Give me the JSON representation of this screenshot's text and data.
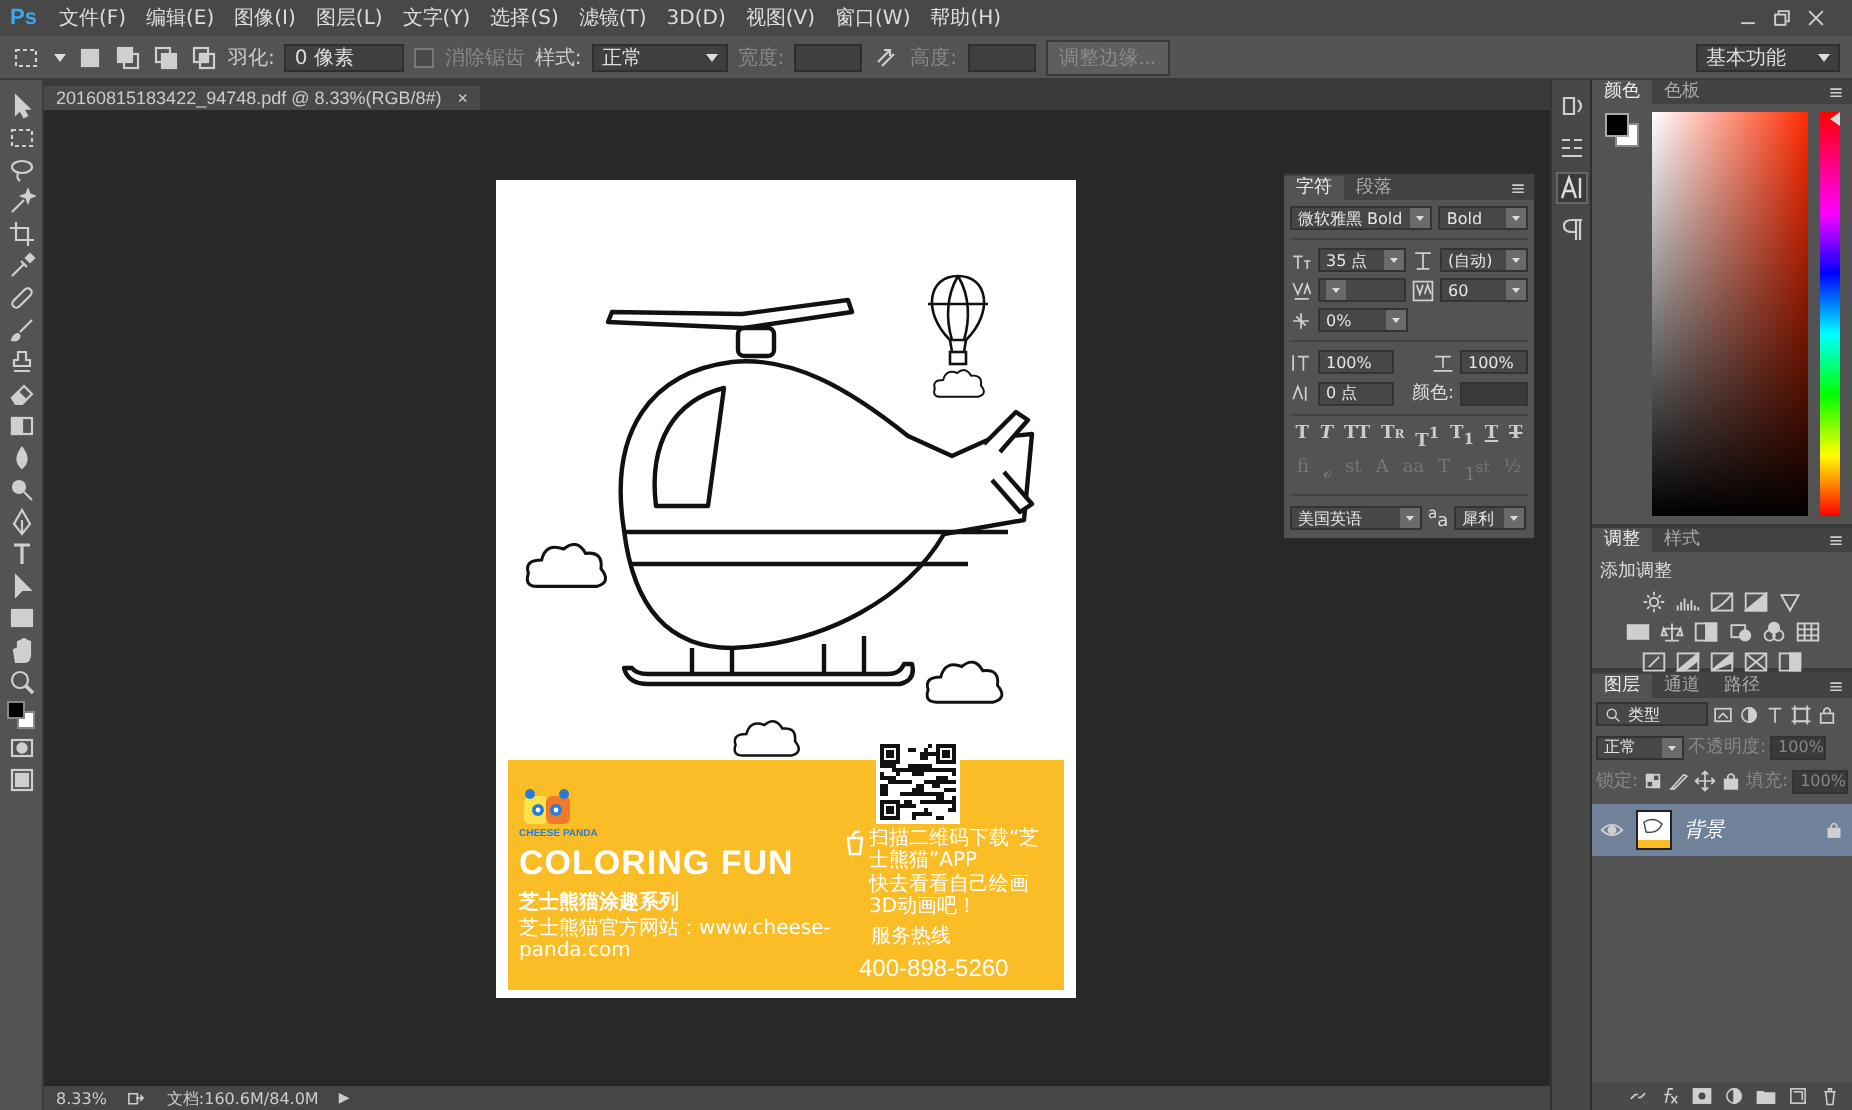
{
  "menu_bar": {
    "logo": "Ps",
    "items": [
      "文件(F)",
      "编辑(E)",
      "图像(I)",
      "图层(L)",
      "文字(Y)",
      "选择(S)",
      "滤镜(T)",
      "3D(D)",
      "视图(V)",
      "窗口(W)",
      "帮助(H)"
    ]
  },
  "options_bar": {
    "feather_label": "羽化:",
    "feather_value": "0 像素",
    "anti_alias": {
      "label": "消除锯齿",
      "checked": false,
      "disabled": true
    },
    "style_label": "样式:",
    "style_value": "正常",
    "width_label": "宽度:",
    "height_label": "高度:",
    "refine_edge": {
      "label": "调整边缘...",
      "disabled": true
    },
    "workspace": "基本功能"
  },
  "document": {
    "tab_title": "20160815183422_94748.pdf @ 8.33%(RGB/8#)",
    "tab_close": "×",
    "artwork": {
      "logo_text": "CHEESE PANDA",
      "headline": "COLORING FUN",
      "series": "芝士熊猫涂趣系列",
      "website": "芝士熊猫官方网站：www.cheese-panda.com",
      "app_lines": [
        "扫描二维码下载“芝士熊猫”APP",
        "快去看看自己绘画3D动画吧！"
      ],
      "hotline_label": "服务热线",
      "hotline": "400-898-5260"
    }
  },
  "character_panel": {
    "tabs": [
      {
        "label": "字符",
        "selected": true
      },
      {
        "label": "段落",
        "selected": false
      }
    ],
    "font_family": "微软雅黑 Bold",
    "font_style": "Bold",
    "font_size": "35 点",
    "leading": "(自动)",
    "tracking": "60",
    "tsume": "0%",
    "vertical_scale": "100%",
    "horizontal_scale": "100%",
    "baseline_shift": "0 点",
    "color_label": "颜色:",
    "style_buttons": [
      {
        "label": "T",
        "kind": "regular"
      },
      {
        "label": "T",
        "kind": "italic"
      },
      {
        "label": "TT",
        "kind": "caps"
      },
      {
        "label": "Tr",
        "kind": "smallcaps"
      },
      {
        "label": "T$^{1}$",
        "kind": "super"
      },
      {
        "label": "T$_{1}$",
        "kind": "sub"
      },
      {
        "label": "T",
        "kind": "underline"
      },
      {
        "label": "T",
        "kind": "strike"
      }
    ],
    "opentype_buttons": [
      {
        "label": "fi",
        "disabled": true
      },
      {
        "label": "ℴ",
        "disabled": true
      },
      {
        "label": "st",
        "disabled": true
      },
      {
        "label": "A",
        "disabled": true
      },
      {
        "label": "aa",
        "disabled": true
      },
      {
        "label": "T",
        "disabled": true
      },
      {
        "label": "1$^{st}$",
        "disabled": true
      },
      {
        "label": "½",
        "disabled": true
      }
    ],
    "language": "美国英语",
    "antialias_label": "$^{a}$a",
    "antialias": "犀利"
  },
  "color_panel": {
    "tabs": [
      {
        "label": "颜色",
        "selected": true
      },
      {
        "label": "色板",
        "selected": false
      }
    ],
    "hue_slider": {
      "level": 1
    }
  },
  "adjustments_panel": {
    "tabs": [
      {
        "label": "调整",
        "selected": true
      },
      {
        "label": "样式",
        "selected": false
      }
    ],
    "heading": "添加调整"
  },
  "layers_panel": {
    "tabs": [
      {
        "label": "图层",
        "selected": true
      },
      {
        "label": "通道",
        "selected": false
      },
      {
        "label": "路径",
        "selected": false
      }
    ],
    "filter": "类型",
    "blend_mode": "正常",
    "opacity_label": "不透明度:",
    "opacity": "100%",
    "lock_label": "锁定:",
    "fill_label": "填充:",
    "fill": "100%",
    "layers": [
      {
        "name": "背景",
        "selected": true,
        "visible": true,
        "locked": true
      }
    ]
  },
  "status_bar": {
    "zoom": "8.33%",
    "doc_size": "文档:160.6M/84.0M",
    "menu_arrow": "▶"
  }
}
